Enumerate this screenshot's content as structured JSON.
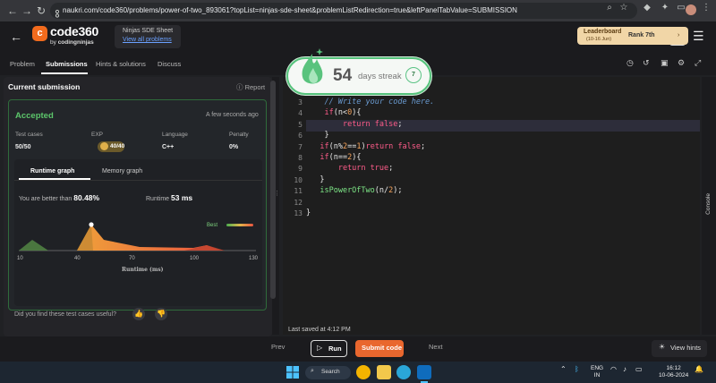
{
  "browser": {
    "url": "naukri.com/code360/problems/power-of-two_893061?topList=ninjas-sde-sheet&problemListRedirection=true&leftPanelTabValue=SUBMISSION"
  },
  "header": {
    "logo_main": "code",
    "logo_num": "360",
    "logo_by": "by",
    "logo_brand": "codingninjas",
    "sheet_title": "Ninjas SDE Sheet",
    "sheet_link": "View all problems",
    "leaderboard_title": "Leaderboard",
    "leaderboard_dates": "(10-16 Jun)",
    "rank_label": "Rank",
    "rank_value": "7th"
  },
  "tabs": [
    {
      "label": "Problem"
    },
    {
      "label": "Submissions"
    },
    {
      "label": "Hints & solutions"
    },
    {
      "label": "Discuss"
    }
  ],
  "submission": {
    "title": "Current submission",
    "report": "Report",
    "status": "Accepted",
    "time_ago": "A few seconds ago",
    "stats": [
      {
        "label": "Test cases",
        "value": "50/50"
      },
      {
        "label": "EXP",
        "value": "40/40"
      },
      {
        "label": "Language",
        "value": "C++"
      },
      {
        "label": "Penalty",
        "value": "0%"
      }
    ],
    "graph_tabs": [
      "Runtime graph",
      "Memory graph"
    ],
    "better_text": "You are better than",
    "better_value": "80.48%",
    "runtime_label": "Runtime",
    "runtime_value": "53 ms",
    "best_label": "Best",
    "axis_title": "Runtime (ms)",
    "useful_text": "Did you find these test cases useful?"
  },
  "chart_data": {
    "type": "area",
    "x": [
      10,
      40,
      70,
      100,
      130
    ],
    "xlabel": "Runtime (ms)",
    "xlim": [
      10,
      130
    ],
    "marker_x": 48,
    "legend": "Best"
  },
  "code": {
    "lines": [
      {
        "n": "3",
        "text": "    // Write your code here."
      },
      {
        "n": "4",
        "text": "    if(n<0){"
      },
      {
        "n": "5",
        "text": "        return false;"
      },
      {
        "n": "6",
        "text": "    }"
      },
      {
        "n": "7",
        "text": "   if(n%2==1)return false;"
      },
      {
        "n": "8",
        "text": "   if(n==2){"
      },
      {
        "n": "9",
        "text": "       return true;"
      },
      {
        "n": "10",
        "text": "   }"
      },
      {
        "n": "11",
        "text": "   isPowerOfTwo(n/2);"
      },
      {
        "n": "12",
        "text": ""
      },
      {
        "n": "13",
        "text": "}"
      }
    ],
    "last_saved": "Last saved at 4:12 PM"
  },
  "streak": {
    "count": "54",
    "label": "days streak",
    "badge": "7"
  },
  "bottombar": {
    "prev": "Prev",
    "run": "Run",
    "submit": "Submit code",
    "next": "Next",
    "hints": "View hints"
  },
  "console": {
    "label": "Console"
  },
  "taskbar": {
    "search": "Search",
    "lang1": "ENG",
    "lang2": "IN",
    "time": "16:12",
    "date": "10-06-2024"
  },
  "colors": {
    "accent_orange": "#e9672e",
    "success_green": "#5cc66b",
    "streak_green": "#55c27b"
  }
}
